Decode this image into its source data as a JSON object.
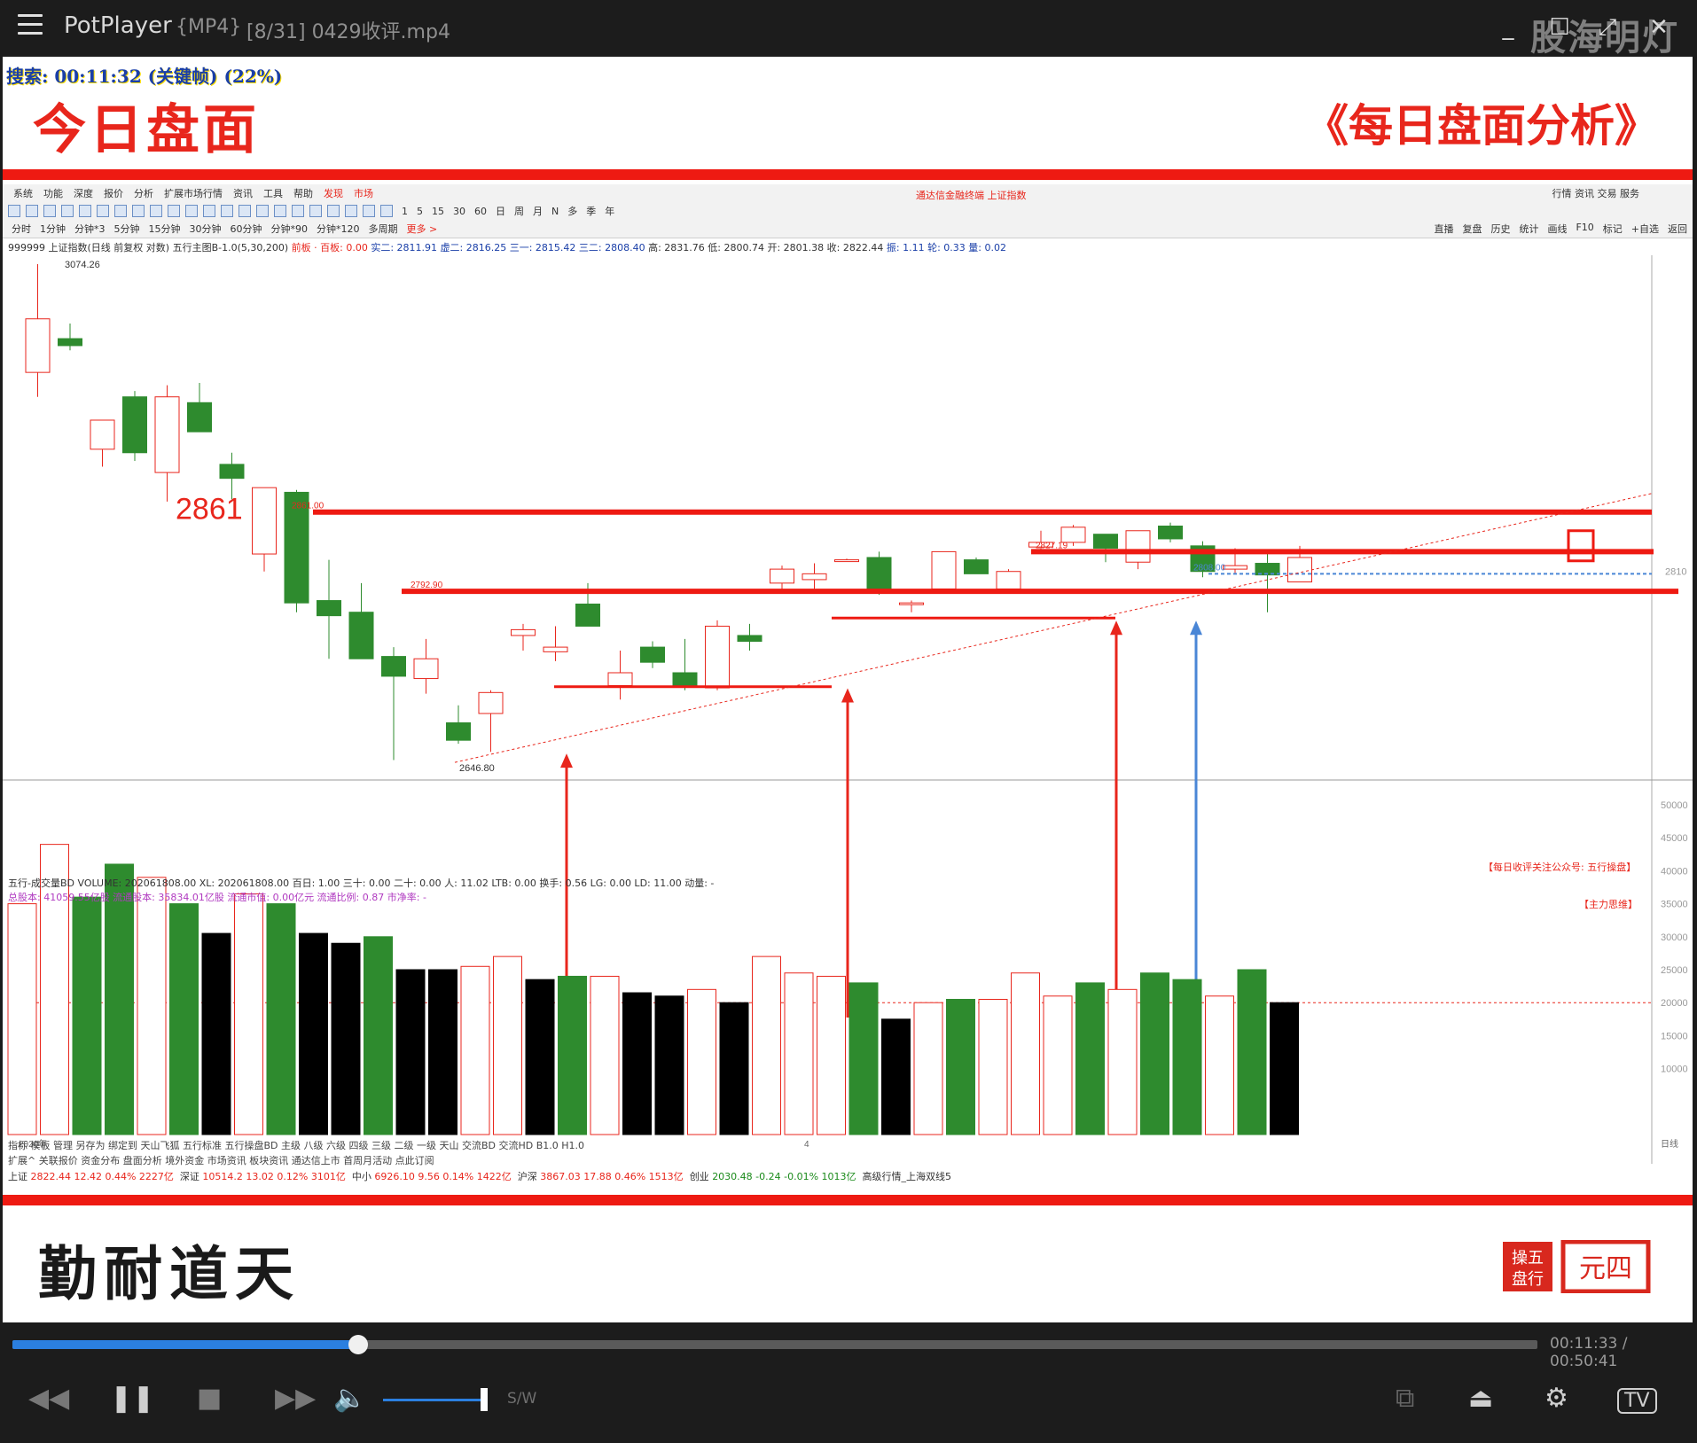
{
  "window": {
    "app_name": "PotPlayer",
    "format": "{MP4}",
    "filename": "[8/31] 0429收评.mp4",
    "watermark": "股海明灯"
  },
  "slide": {
    "seek_status": "搜索: 00:11:32 (关键帧) (22%)",
    "title": "今日盘面",
    "subtitle": "《每日盘面分析》",
    "calligraphy": "勤耐道天",
    "seal_text_1": "操盘五行",
    "seal_text_2": "元四"
  },
  "software": {
    "menu": [
      "系统",
      "功能",
      "深度",
      "报价",
      "分析",
      "扩展市场行情",
      "资讯",
      "工具",
      "帮助",
      "发现",
      "市场"
    ],
    "title": "通达信金融终端 上证指数",
    "right_menu": [
      "行情",
      "资讯",
      "交易",
      "服务"
    ],
    "periods": [
      "分时",
      "1分钟",
      "分钟*3",
      "5分钟",
      "15分钟",
      "30分钟",
      "60分钟",
      "分钟*90",
      "分钟*120",
      "多周期",
      "更多 >"
    ],
    "period_numbers": [
      "1",
      "5",
      "15",
      "30",
      "60",
      "日",
      "周",
      "月",
      "N",
      "多",
      "季",
      "年"
    ],
    "right_tabs": [
      "直播",
      "复盘",
      "历史",
      "统计",
      "画线",
      "F10",
      "标记",
      "+自选",
      "返回"
    ],
    "info_line": {
      "name": "999999 上证指数(日线 前复权 对数)",
      "indicator": "五行主图B-1.0(5,30,200)",
      "red_part": "前板 · 百板: 0.00",
      "blue_part": "实二: 2811.91  虚二: 2816.25  三一: 2815.42  三二: 2808.40",
      "ohlc": "高: 2831.76  低: 2800.74  开: 2801.38  收: 2822.44",
      "tail": "振: 1.11  轮: 0.33  量: 0.02"
    },
    "volume_header": "五行-成交量BD    VOLUME: 202061808.00  XL: 202061808.00  百日: 1.00  三十: 0.00  二十: 0.00  人: 11.02  LTB: 0.00  换手: 0.56    LG: 0.00  LD: 11.00  动量: -",
    "volume_header2": "总股本:      41059.55亿股     流通股本:      35834.01亿股     流通市值:        0.00亿元       流通比例:      0.87       市净率:       -",
    "annot_wechat": "【每日收评关注公众号: 五行操盘】",
    "annot_main": "【主力思维】",
    "bottom_tabs": "指标  模板  管理  另存为  绑定到  天山飞狐  五行标准  五行操盘BD  主级  八级  六级  四级  三级  二级  一级  天山  交流BD  交流HD  B1.0  H1.0",
    "bottom_tabs2": "扩展^  关联报价  资金分布  盘面分析  境外资金  市场资讯  板块资讯  通达信上市 首周月活动 点此订阅",
    "ticker": {
      "sh_label": "上证",
      "sh": "2822.44   12.42  0.44%  2227亿",
      "sz_label": "深证",
      "sz": "10514.2   13.02  0.12%  3101亿",
      "zx_label": "中小",
      "zx": "6926.10   9.56  0.14%  1422亿",
      "hs_label": "沪深",
      "hs": "3867.03   17.88  0.46%  1513亿",
      "cy_label": "创业",
      "cy": "2030.48   -0.24  -0.01%  1013亿",
      "extra": "高级行情_上海双线5"
    },
    "year_label": "2020年",
    "x_mid_label": "4",
    "period_label": "日线"
  },
  "player": {
    "time": "00:11:33 / 00:50:41",
    "progress": 0.227,
    "volume_level": 1.0,
    "sw_label": "S/W"
  },
  "chart_data": {
    "type": "candlestick",
    "title": "999999 上证指数",
    "price_labels": [
      "3074.26",
      "2861",
      "2861.00",
      "2792.90",
      "2827.19",
      "2808.00",
      "2646.80",
      "2810"
    ],
    "candles": [
      {
        "o": 2981,
        "h": 3074,
        "l": 2960,
        "c": 3027,
        "up": true
      },
      {
        "o": 3010,
        "h": 3023,
        "l": 3000,
        "c": 3004,
        "up": false
      },
      {
        "o": 2915,
        "h": 2938,
        "l": 2900,
        "c": 2940,
        "up": true
      },
      {
        "o": 2960,
        "h": 2965,
        "l": 2905,
        "c": 2912,
        "up": false
      },
      {
        "o": 2895,
        "h": 2970,
        "l": 2870,
        "c": 2960,
        "up": true
      },
      {
        "o": 2955,
        "h": 2972,
        "l": 2940,
        "c": 2930,
        "up": false
      },
      {
        "o": 2902,
        "h": 2912,
        "l": 2872,
        "c": 2890,
        "up": false
      },
      {
        "o": 2825,
        "h": 2875,
        "l": 2810,
        "c": 2882,
        "up": true
      },
      {
        "o": 2878,
        "h": 2880,
        "l": 2775,
        "c": 2783,
        "up": false
      },
      {
        "o": 2785,
        "h": 2820,
        "l": 2735,
        "c": 2772,
        "up": false
      },
      {
        "o": 2775,
        "h": 2800,
        "l": 2735,
        "c": 2735,
        "up": false
      },
      {
        "o": 2737,
        "h": 2745,
        "l": 2648,
        "c": 2720,
        "up": false
      },
      {
        "o": 2718,
        "h": 2752,
        "l": 2705,
        "c": 2735,
        "up": true
      },
      {
        "o": 2680,
        "h": 2695,
        "l": 2662,
        "c": 2665,
        "up": false
      },
      {
        "o": 2688,
        "h": 2708,
        "l": 2655,
        "c": 2706,
        "up": true
      },
      {
        "o": 2755,
        "h": 2765,
        "l": 2742,
        "c": 2760,
        "up": true
      },
      {
        "o": 2741,
        "h": 2763,
        "l": 2733,
        "c": 2745,
        "up": true
      },
      {
        "o": 2782,
        "h": 2800,
        "l": 2770,
        "c": 2763,
        "up": false
      },
      {
        "o": 2712,
        "h": 2742,
        "l": 2700,
        "c": 2723,
        "up": true
      },
      {
        "o": 2745,
        "h": 2750,
        "l": 2727,
        "c": 2732,
        "up": false
      },
      {
        "o": 2723,
        "h": 2752,
        "l": 2708,
        "c": 2712,
        "up": false
      },
      {
        "o": 2710,
        "h": 2768,
        "l": 2708,
        "c": 2763,
        "up": true
      },
      {
        "o": 2755,
        "h": 2765,
        "l": 2742,
        "c": 2750,
        "up": false
      },
      {
        "o": 2800,
        "h": 2815,
        "l": 2793,
        "c": 2812,
        "up": true
      },
      {
        "o": 2803,
        "h": 2817,
        "l": 2795,
        "c": 2808,
        "up": true
      },
      {
        "o": 2819,
        "h": 2821,
        "l": 2819,
        "c": 2820,
        "up": true
      },
      {
        "o": 2822,
        "h": 2827,
        "l": 2790,
        "c": 2792,
        "up": false
      },
      {
        "o": 2782,
        "h": 2785,
        "l": 2775,
        "c": 2783,
        "up": true
      },
      {
        "o": 2795,
        "h": 2827,
        "l": 2793,
        "c": 2827,
        "up": true
      },
      {
        "o": 2820,
        "h": 2822,
        "l": 2808,
        "c": 2808,
        "up": false
      },
      {
        "o": 2795,
        "h": 2812,
        "l": 2795,
        "c": 2810,
        "up": true
      },
      {
        "o": 2831,
        "h": 2845,
        "l": 2828,
        "c": 2835,
        "up": true
      },
      {
        "o": 2835,
        "h": 2850,
        "l": 2832,
        "c": 2848,
        "up": true
      },
      {
        "o": 2842,
        "h": 2842,
        "l": 2818,
        "c": 2830,
        "up": false
      },
      {
        "o": 2818,
        "h": 2845,
        "l": 2812,
        "c": 2845,
        "up": true
      },
      {
        "o": 2849,
        "h": 2852,
        "l": 2835,
        "c": 2838,
        "up": false
      },
      {
        "o": 2832,
        "h": 2836,
        "l": 2805,
        "c": 2810,
        "up": false
      },
      {
        "o": 2812,
        "h": 2830,
        "l": 2808,
        "c": 2815,
        "up": true
      },
      {
        "o": 2817,
        "h": 2825,
        "l": 2775,
        "c": 2807,
        "up": false
      },
      {
        "o": 2801,
        "h": 2832,
        "l": 2801,
        "c": 2822,
        "up": true
      }
    ],
    "volume_axis": [
      "50000",
      "45000",
      "40000",
      "35000",
      "30000",
      "25000",
      "20000",
      "15000",
      "10000"
    ],
    "volumes": [
      {
        "v": 35000,
        "t": "up"
      },
      {
        "v": 44000,
        "t": "up"
      },
      {
        "v": 36000,
        "t": "down"
      },
      {
        "v": 41000,
        "t": "down"
      },
      {
        "v": 39000,
        "t": "up"
      },
      {
        "v": 35000,
        "t": "down"
      },
      {
        "v": 30500,
        "t": "black"
      },
      {
        "v": 36500,
        "t": "up"
      },
      {
        "v": 35000,
        "t": "down"
      },
      {
        "v": 30500,
        "t": "black"
      },
      {
        "v": 29000,
        "t": "black"
      },
      {
        "v": 30000,
        "t": "down"
      },
      {
        "v": 25000,
        "t": "black"
      },
      {
        "v": 25000,
        "t": "black"
      },
      {
        "v": 25500,
        "t": "up"
      },
      {
        "v": 27000,
        "t": "up"
      },
      {
        "v": 23500,
        "t": "black"
      },
      {
        "v": 24000,
        "t": "down"
      },
      {
        "v": 24000,
        "t": "up"
      },
      {
        "v": 21500,
        "t": "black"
      },
      {
        "v": 21000,
        "t": "black"
      },
      {
        "v": 22000,
        "t": "up"
      },
      {
        "v": 20000,
        "t": "black"
      },
      {
        "v": 27000,
        "t": "up"
      },
      {
        "v": 24500,
        "t": "up"
      },
      {
        "v": 24000,
        "t": "up"
      },
      {
        "v": 23000,
        "t": "down"
      },
      {
        "v": 17500,
        "t": "black"
      },
      {
        "v": 20000,
        "t": "up"
      },
      {
        "v": 20500,
        "t": "down"
      },
      {
        "v": 20500,
        "t": "up"
      },
      {
        "v": 24500,
        "t": "up"
      },
      {
        "v": 21000,
        "t": "up"
      },
      {
        "v": 23000,
        "t": "down"
      },
      {
        "v": 22000,
        "t": "up"
      },
      {
        "v": 24500,
        "t": "down"
      },
      {
        "v": 23500,
        "t": "down"
      },
      {
        "v": 21000,
        "t": "up"
      },
      {
        "v": 25000,
        "t": "down"
      },
      {
        "v": 20000,
        "t": "black"
      }
    ]
  },
  "colors": {
    "accent_red": "#ee1a12",
    "candle_green": "#2e8b2e",
    "candle_red": "#e8261c",
    "progress_blue": "#2b7fe0"
  }
}
